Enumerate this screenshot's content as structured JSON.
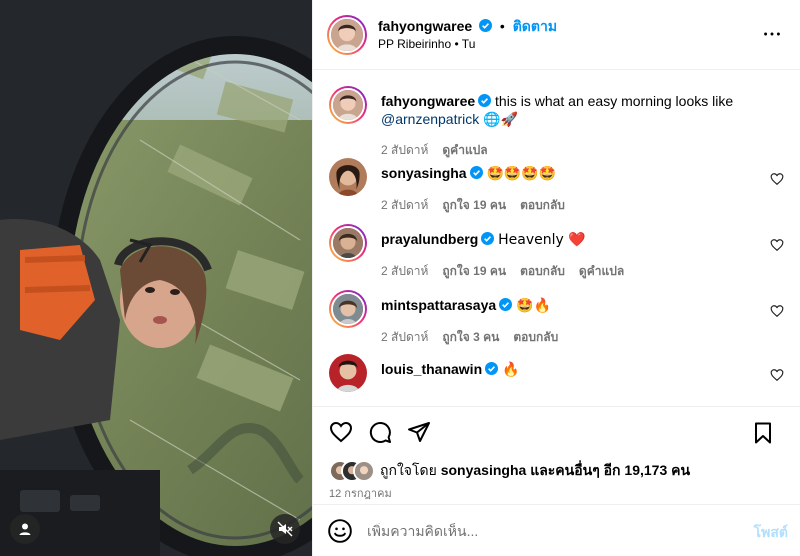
{
  "post": {
    "username": "fahyongwaree",
    "follow_label": "ติดตาม",
    "location": "PP Ribeirinho • Tu",
    "caption_text": "this is what an easy morning looks like",
    "caption_mention": "@arnzenpatrick",
    "caption_emoji": "🌐🚀",
    "caption_time": "2 สัปดาห์",
    "caption_translate": "ดูคำแปล"
  },
  "comments": [
    {
      "username": "sonyasingha",
      "text": "🤩🤩🤩🤩",
      "time": "2 สัปดาห์",
      "likes": "ถูกใจ 19 คน",
      "reply": "ตอบกลับ",
      "translate": ""
    },
    {
      "username": "prayalundberg",
      "text": "Heavenly ❤️",
      "time": "2 สัปดาห์",
      "likes": "ถูกใจ 19 คน",
      "reply": "ตอบกลับ",
      "translate": "ดูคำแปล"
    },
    {
      "username": "mintspattarasaya",
      "text": "🤩🔥",
      "time": "2 สัปดาห์",
      "likes": "ถูกใจ 3 คน",
      "reply": "ตอบกลับ",
      "translate": ""
    },
    {
      "username": "louis_thanawin",
      "text": "🔥",
      "time": "",
      "likes": "",
      "reply": "",
      "translate": ""
    }
  ],
  "likes": {
    "prefix": "ถูกใจโดย",
    "first_user": "sonyasingha",
    "suffix": "และคนอื่นๆ อีก 19,173 คน"
  },
  "date": "12 กรกฎาคม",
  "add_comment": {
    "placeholder": "เพิ่มความคิดเห็น...",
    "post_label": "โพสต์"
  },
  "icons": {
    "more": "more-horizontal-icon",
    "like": "heart-icon",
    "comment": "comment-bubble-icon",
    "share": "paper-plane-icon",
    "save": "bookmark-icon",
    "emoji": "smiley-icon",
    "mute": "speaker-muted-icon",
    "tag": "user-tag-icon",
    "verified": "verified-badge-icon"
  },
  "colors": {
    "accent": "#0095f6",
    "verified": "#0095f6",
    "muted_text": "#737373",
    "post_disabled": "#b2dffc",
    "border": "#efefef"
  }
}
